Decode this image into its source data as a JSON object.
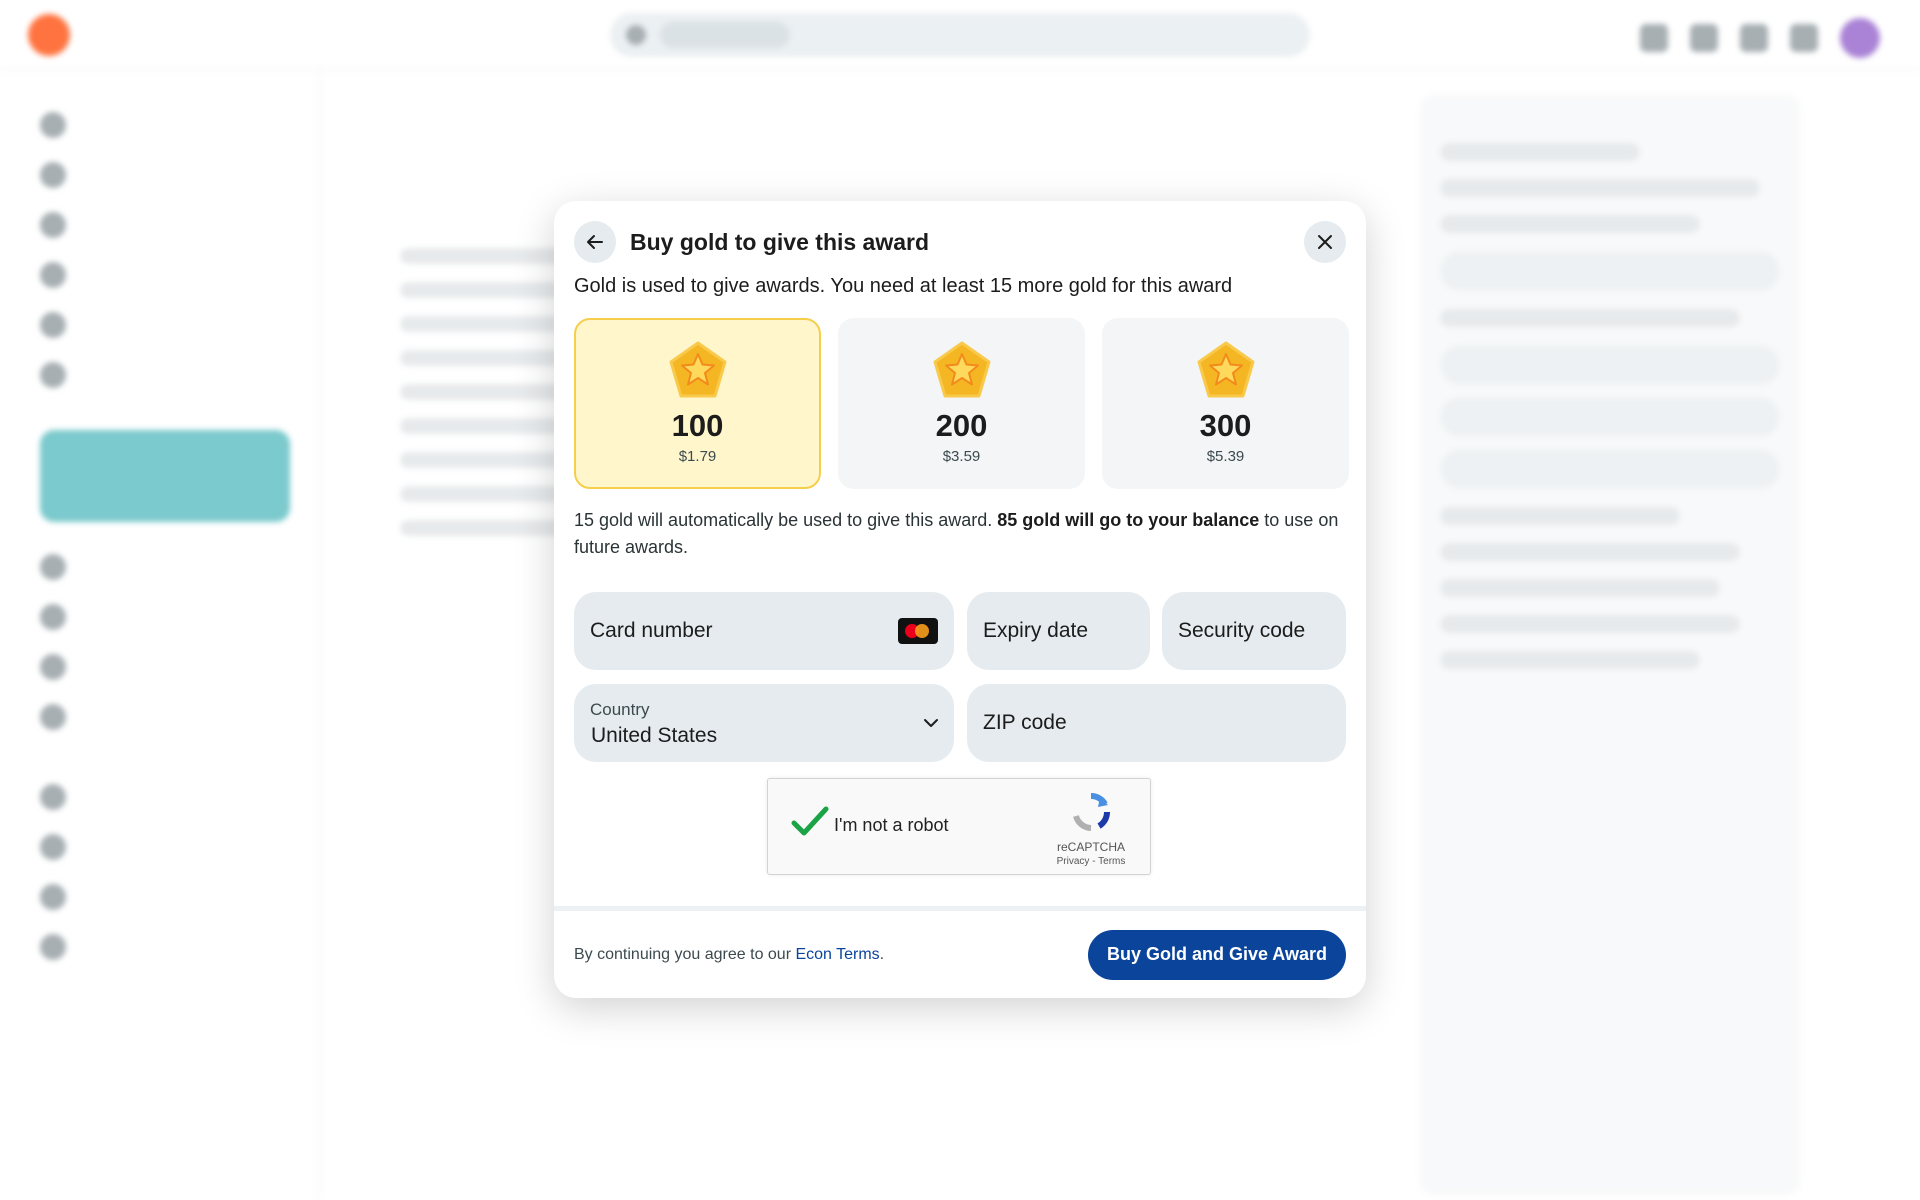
{
  "modal": {
    "title": "Buy gold to give this award",
    "subtitle": "Gold is used to give awards. You need at least 15 more gold for this award",
    "packages": [
      {
        "amount": "100",
        "price": "$1.79",
        "selected": true
      },
      {
        "amount": "200",
        "price": "$3.59",
        "selected": false
      },
      {
        "amount": "300",
        "price": "$5.39",
        "selected": false
      }
    ],
    "note": {
      "part1": "15 gold will automatically be used to give this award. ",
      "bold": "85 gold will go to your balance",
      "part2": " to use on future awards."
    },
    "form": {
      "card_number": "Card number",
      "expiry": "Expiry date",
      "security": "Security code",
      "country_label": "Country",
      "country_value": "United States",
      "zip": "ZIP code"
    },
    "captcha": {
      "label": "I'm not a robot",
      "brand": "reCAPTCHA",
      "links": "Privacy - Terms"
    },
    "footer": {
      "text": "By continuing you agree to our ",
      "link": "Econ Terms",
      "period": ".",
      "button": "Buy Gold and Give Award"
    }
  },
  "colors": {
    "accent": "#0a449b",
    "selected_bg": "#fff6cc",
    "selected_border": "#f5cf4b",
    "field_bg": "#e5ebee"
  }
}
